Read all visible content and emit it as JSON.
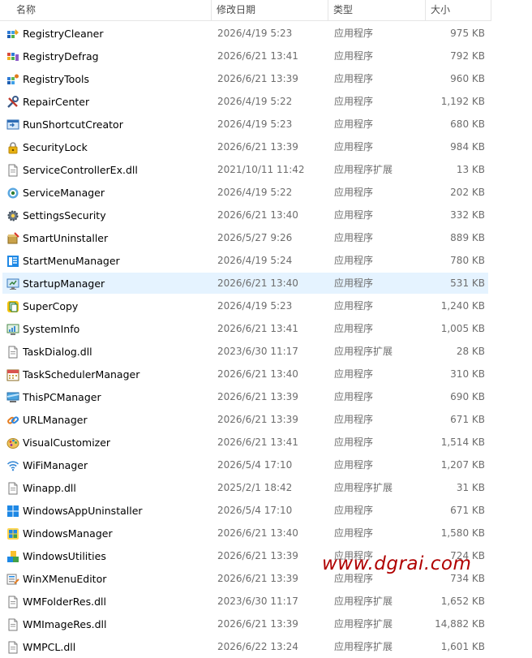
{
  "header": {
    "name": "名称",
    "date": "修改日期",
    "type": "类型",
    "size": "大小",
    "sort_arrow": "^"
  },
  "files": [
    {
      "name": "RegistryCleaner",
      "date": "2026/4/19 5:23",
      "type": "应用程序",
      "size": "975 KB",
      "icon": "registry-cleaner-icon"
    },
    {
      "name": "RegistryDefrag",
      "date": "2026/6/21 13:41",
      "type": "应用程序",
      "size": "792 KB",
      "icon": "registry-defrag-icon"
    },
    {
      "name": "RegistryTools",
      "date": "2026/6/21 13:39",
      "type": "应用程序",
      "size": "960 KB",
      "icon": "registry-tools-icon"
    },
    {
      "name": "RepairCenter",
      "date": "2026/4/19 5:22",
      "type": "应用程序",
      "size": "1,192 KB",
      "icon": "repair-tools-icon"
    },
    {
      "name": "RunShortcutCreator",
      "date": "2026/4/19 5:23",
      "type": "应用程序",
      "size": "680 KB",
      "icon": "run-window-icon"
    },
    {
      "name": "SecurityLock",
      "date": "2026/6/21 13:39",
      "type": "应用程序",
      "size": "984 KB",
      "icon": "padlock-icon"
    },
    {
      "name": "ServiceControllerEx.dll",
      "date": "2021/10/11 11:42",
      "type": "应用程序扩展",
      "size": "13 KB",
      "icon": "dll-file-icon"
    },
    {
      "name": "ServiceManager",
      "date": "2026/4/19 5:22",
      "type": "应用程序",
      "size": "202 KB",
      "icon": "service-gear-icon"
    },
    {
      "name": "SettingsSecurity",
      "date": "2026/6/21 13:40",
      "type": "应用程序",
      "size": "332 KB",
      "icon": "settings-gear-icon"
    },
    {
      "name": "SmartUninstaller",
      "date": "2026/5/27 9:26",
      "type": "应用程序",
      "size": "889 KB",
      "icon": "uninstaller-icon"
    },
    {
      "name": "StartMenuManager",
      "date": "2026/4/19 5:24",
      "type": "应用程序",
      "size": "780 KB",
      "icon": "start-menu-icon"
    },
    {
      "name": "StartupManager",
      "date": "2026/6/21 13:40",
      "type": "应用程序",
      "size": "531 KB",
      "icon": "startup-monitor-icon"
    },
    {
      "name": "SuperCopy",
      "date": "2026/4/19 5:23",
      "type": "应用程序",
      "size": "1,240 KB",
      "icon": "super-copy-icon"
    },
    {
      "name": "SystemInfo",
      "date": "2026/6/21 13:41",
      "type": "应用程序",
      "size": "1,005 KB",
      "icon": "system-info-monitor-icon"
    },
    {
      "name": "TaskDialog.dll",
      "date": "2023/6/30 11:17",
      "type": "应用程序扩展",
      "size": "28 KB",
      "icon": "dll-file-icon"
    },
    {
      "name": "TaskSchedulerManager",
      "date": "2026/6/21 13:40",
      "type": "应用程序",
      "size": "310 KB",
      "icon": "calendar-icon"
    },
    {
      "name": "ThisPCManager",
      "date": "2026/6/21 13:39",
      "type": "应用程序",
      "size": "690 KB",
      "icon": "this-pc-icon"
    },
    {
      "name": "URLManager",
      "date": "2026/6/21 13:39",
      "type": "应用程序",
      "size": "671 KB",
      "icon": "link-icon"
    },
    {
      "name": "VisualCustomizer",
      "date": "2026/6/21 13:41",
      "type": "应用程序",
      "size": "1,514 KB",
      "icon": "palette-icon"
    },
    {
      "name": "WiFiManager",
      "date": "2026/5/4 17:10",
      "type": "应用程序",
      "size": "1,207 KB",
      "icon": "wifi-icon"
    },
    {
      "name": "Winapp.dll",
      "date": "2025/2/1 18:42",
      "type": "应用程序扩展",
      "size": "31 KB",
      "icon": "dll-file-icon"
    },
    {
      "name": "WindowsAppUninstaller",
      "date": "2026/5/4 17:10",
      "type": "应用程序",
      "size": "671 KB",
      "icon": "windows-logo-icon"
    },
    {
      "name": "WindowsManager",
      "date": "2026/6/21 13:40",
      "type": "应用程序",
      "size": "1,580 KB",
      "icon": "windows-manager-icon"
    },
    {
      "name": "WindowsUtilities",
      "date": "2026/6/21 13:39",
      "type": "应用程序",
      "size": "724 KB",
      "icon": "utilities-blocks-icon"
    },
    {
      "name": "WinXMenuEditor",
      "date": "2026/6/21 13:39",
      "type": "应用程序",
      "size": "734 KB",
      "icon": "menu-editor-icon"
    },
    {
      "name": "WMFolderRes.dll",
      "date": "2023/6/30 11:17",
      "type": "应用程序扩展",
      "size": "1,652 KB",
      "icon": "dll-file-icon"
    },
    {
      "name": "WMImageRes.dll",
      "date": "2026/6/21 13:39",
      "type": "应用程序扩展",
      "size": "14,882 KB",
      "icon": "dll-file-icon"
    },
    {
      "name": "WMPCL.dll",
      "date": "2026/6/22 13:24",
      "type": "应用程序扩展",
      "size": "1,601 KB",
      "icon": "dll-file-icon"
    }
  ],
  "selected_index": 11,
  "watermark": "www.dgrai.com",
  "colors": {
    "selection": "#e5f3ff",
    "watermark": "#b00000",
    "header_text": "#4c4c4c",
    "muted_text": "#6d6d6d"
  }
}
